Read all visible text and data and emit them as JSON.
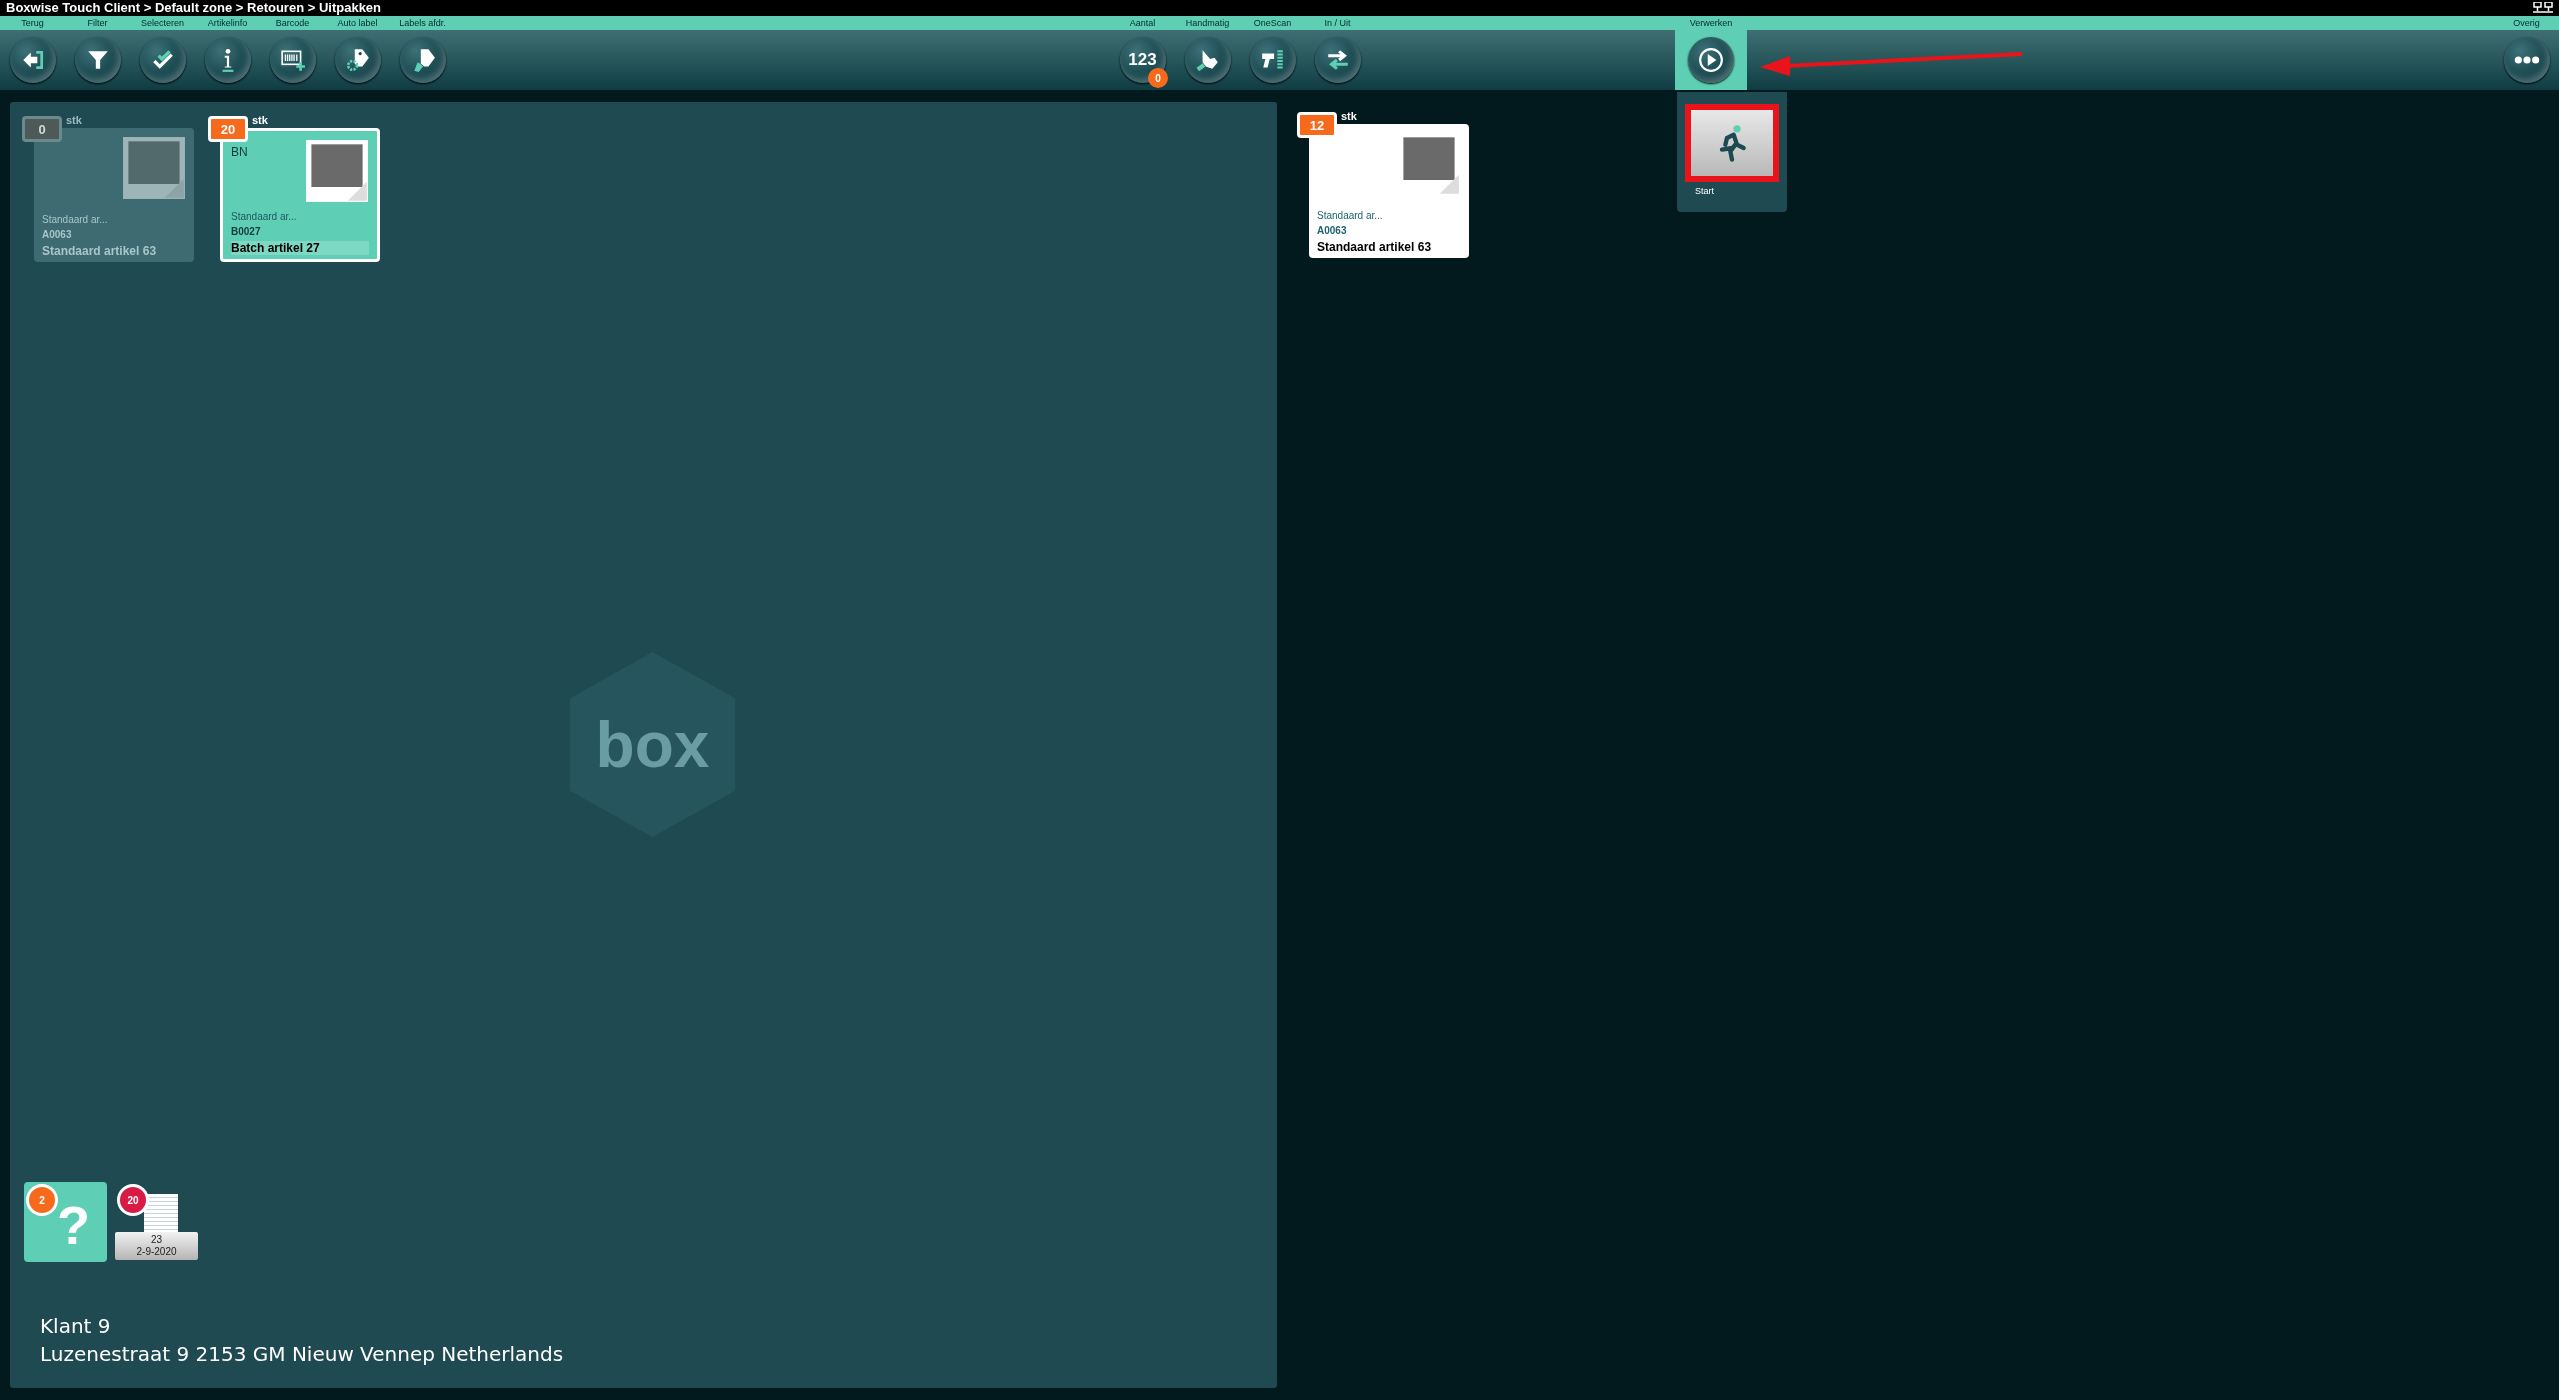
{
  "window": {
    "title": "Boxwise Touch Client > Default zone > Retouren > Uitpakken"
  },
  "toolbar": {
    "left": [
      {
        "label": "Terug",
        "selected": false
      },
      {
        "label": "Filter",
        "selected": false
      },
      {
        "label": "Selecteren",
        "selected": false
      },
      {
        "label": "Artikelinfo",
        "selected": false
      },
      {
        "label": "Barcode",
        "selected": false
      },
      {
        "label": "Auto label",
        "selected": false
      },
      {
        "label": "Labels afdr.",
        "selected": false
      }
    ],
    "middle": [
      {
        "label": "Aantal",
        "value": "123",
        "badge": "0",
        "selected": false
      },
      {
        "label": "Handmatig",
        "selected": false
      },
      {
        "label": "OneScan",
        "selected": false
      },
      {
        "label": "In / Uit",
        "selected": false
      }
    ],
    "process": {
      "label": "Verwerken",
      "selected": true
    },
    "more": {
      "label": "Overig",
      "selected": false
    }
  },
  "process_menu": {
    "items": [
      {
        "label": "Start",
        "highlighted": true
      }
    ]
  },
  "left_panel": {
    "watermark": "box",
    "cards": [
      {
        "count": "0",
        "unit": "stk",
        "description": "Standaard ar...",
        "code": "A0063",
        "name": "Standaard artikel 63",
        "disabled": true,
        "selected": false
      },
      {
        "count": "20",
        "unit": "stk",
        "batch": "BN",
        "description": "Standaard ar...",
        "code": "B0027",
        "name": "Batch artikel 27",
        "disabled": false,
        "selected": true
      }
    ],
    "unknown_tile": {
      "symbol": "?",
      "badge": "2"
    },
    "document": {
      "badge": "20",
      "number": "23",
      "date": "2-9-2020"
    },
    "customer": {
      "name": "Klant 9",
      "address": "Luzenestraat 9 2153 GM Nieuw Vennep Netherlands"
    }
  },
  "right_panel": {
    "cards": [
      {
        "count": "12",
        "unit": "stk",
        "description": "Standaard ar...",
        "code": "A0063",
        "name": "Standaard artikel 63",
        "disabled": false,
        "selected": false
      }
    ]
  },
  "annotation": {
    "arrow": true
  }
}
